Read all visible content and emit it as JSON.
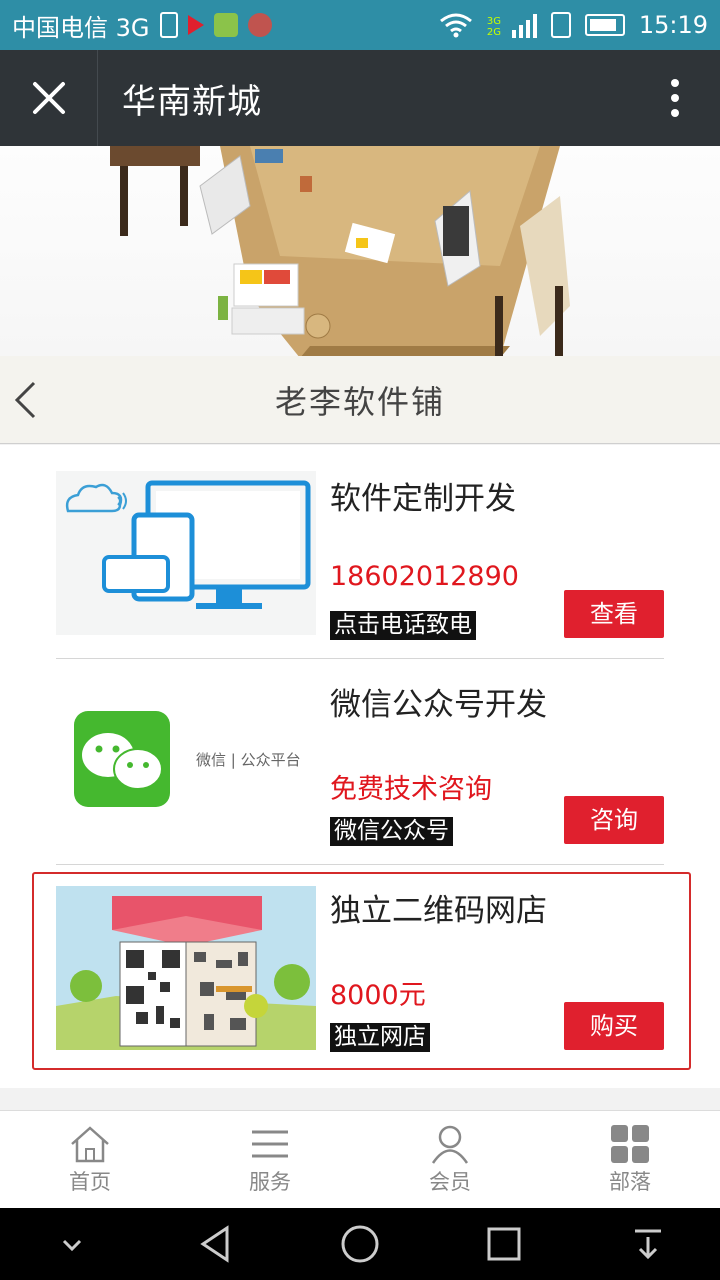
{
  "status_bar": {
    "carrier": "中国电信 3G",
    "network_badge": "3G 2G",
    "time": "15:19"
  },
  "title_bar": {
    "title": "华南新城",
    "close_icon": "close-icon",
    "more_icon": "more-vertical-icon"
  },
  "shop": {
    "title": "老李软件铺",
    "back_icon": "chevron-left-icon"
  },
  "items": [
    {
      "name": "软件定制开发",
      "price": "18602012890",
      "tag": "点击电话致电",
      "action": "查看",
      "image": "devices-illustration"
    },
    {
      "name": "微信公众号开发",
      "price": "免费技术咨询",
      "tag": "微信公众号",
      "action": "咨询",
      "image": "wechat-logo",
      "image_caption": "微信 | 公众平台"
    },
    {
      "name": "独立二维码网店",
      "price": "8000元",
      "tag": "独立网店",
      "action": "购买",
      "image": "qr-building-illustration"
    }
  ],
  "tabs": [
    {
      "label": "首页",
      "icon": "home-icon"
    },
    {
      "label": "服务",
      "icon": "list-icon"
    },
    {
      "label": "会员",
      "icon": "user-icon"
    },
    {
      "label": "部落",
      "icon": "grid-icon"
    }
  ],
  "colors": {
    "status_bar": "#2e8ea6",
    "title_bar": "#2f3438",
    "accent_red": "#e0202e"
  }
}
